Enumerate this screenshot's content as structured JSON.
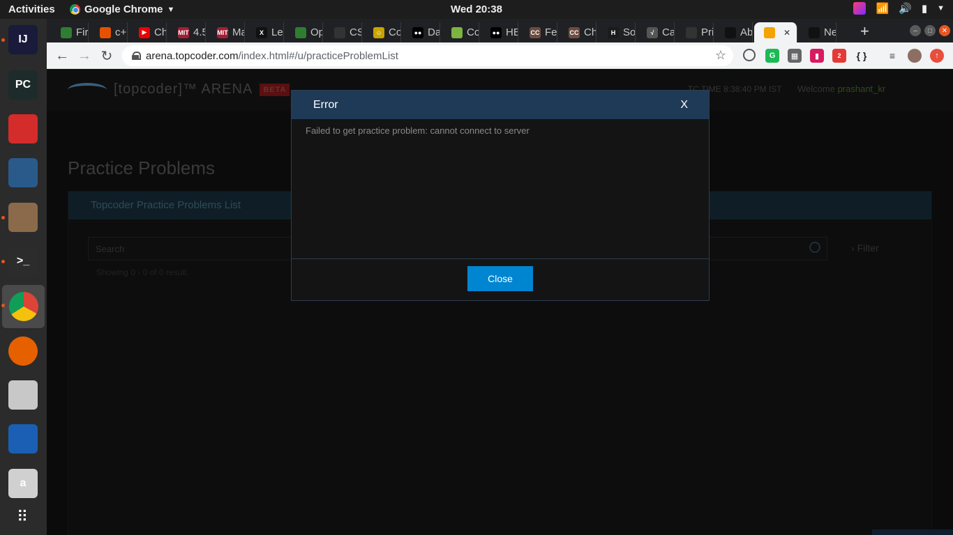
{
  "system": {
    "activities": "Activities",
    "app_name": "Google Chrome",
    "clock": "Wed 20:38"
  },
  "dock": {
    "items": [
      {
        "name": "intellij-icon",
        "label": "IJ",
        "color": "#1a1a3a"
      },
      {
        "name": "pycharm-icon",
        "label": "PC",
        "color": "#1d2b2b"
      },
      {
        "name": "rocketchat-icon",
        "label": "",
        "color": "#d42b2b"
      },
      {
        "name": "mysql-workbench-icon",
        "label": "",
        "color": "#2a5a8a"
      },
      {
        "name": "files-icon",
        "label": "",
        "color": "#8a6a4a"
      },
      {
        "name": "terminal-icon",
        "label": ">_",
        "color": "#2c2c2c"
      },
      {
        "name": "chrome-icon",
        "label": "",
        "color": "#3a3a3a"
      },
      {
        "name": "firefox-icon",
        "label": "",
        "color": "#e66000"
      },
      {
        "name": "rhythmbox-icon",
        "label": "",
        "color": "#c8c8c8"
      },
      {
        "name": "thunderbird-icon",
        "label": "",
        "color": "#1a5fb4"
      },
      {
        "name": "amazon-icon",
        "label": "a",
        "color": "#d0d0d0"
      }
    ],
    "apps_grid": "apps-grid-icon"
  },
  "tabs": [
    {
      "label": "Fir",
      "fav": "",
      "fav_color": "#2e7d32"
    },
    {
      "label": "c+",
      "fav": "",
      "fav_color": "#e65100"
    },
    {
      "label": "Ch",
      "fav": "▶",
      "fav_color": "#e00"
    },
    {
      "label": "4.5",
      "fav": "MIT",
      "fav_color": "#a31f34"
    },
    {
      "label": "Ma",
      "fav": "MIT",
      "fav_color": "#a31f34"
    },
    {
      "label": "Le",
      "fav": "X",
      "fav_color": "#111"
    },
    {
      "label": "Op",
      "fav": "",
      "fav_color": "#2e7d32"
    },
    {
      "label": "CS",
      "fav": "",
      "fav_color": "#333"
    },
    {
      "label": "Co",
      "fav": "☺",
      "fav_color": "#c9a400"
    },
    {
      "label": "Da",
      "fav": "●●",
      "fav_color": "#000"
    },
    {
      "label": "Co",
      "fav": "",
      "fav_color": "#7cb342"
    },
    {
      "label": "HE",
      "fav": "●●",
      "fav_color": "#000"
    },
    {
      "label": "Fe",
      "fav": "CC",
      "fav_color": "#6d4c41"
    },
    {
      "label": "Ch",
      "fav": "CC",
      "fav_color": "#6d4c41"
    },
    {
      "label": "So",
      "fav": "H",
      "fav_color": "#1b1b1b"
    },
    {
      "label": "Ca",
      "fav": "√",
      "fav_color": "#555"
    },
    {
      "label": "Pri",
      "fav": "",
      "fav_color": "#333"
    },
    {
      "label": "Ab",
      "fav": "",
      "fav_color": "#111"
    },
    {
      "label": "",
      "fav": "",
      "fav_color": "#f4a300",
      "active": true,
      "close": "✕"
    },
    {
      "label": "Ne",
      "fav": "",
      "fav_color": "#111"
    }
  ],
  "browser": {
    "url_host": "arena.topcoder.com",
    "url_path": "/index.html#/u/practiceProblemList",
    "new_tab": "+",
    "extension_badge": "2",
    "json_ext": "{ }"
  },
  "arena": {
    "logo_text": "[topcoder]™ ARENA",
    "beta": "BETA",
    "time_label": "TC TIME 8:38:40 PM IST",
    "welcome": "Welcome",
    "username": "prashant_kr",
    "page_title": "Practice Problems",
    "list_title": "Topcoder Practice Problems List",
    "search_placeholder": "Search",
    "filter": "Filter",
    "showing": "Showing 0 - 0 of 0 result."
  },
  "modal": {
    "title": "Error",
    "close_x": "X",
    "message": "Failed to get practice problem: cannot connect to server",
    "close_button": "Close"
  }
}
